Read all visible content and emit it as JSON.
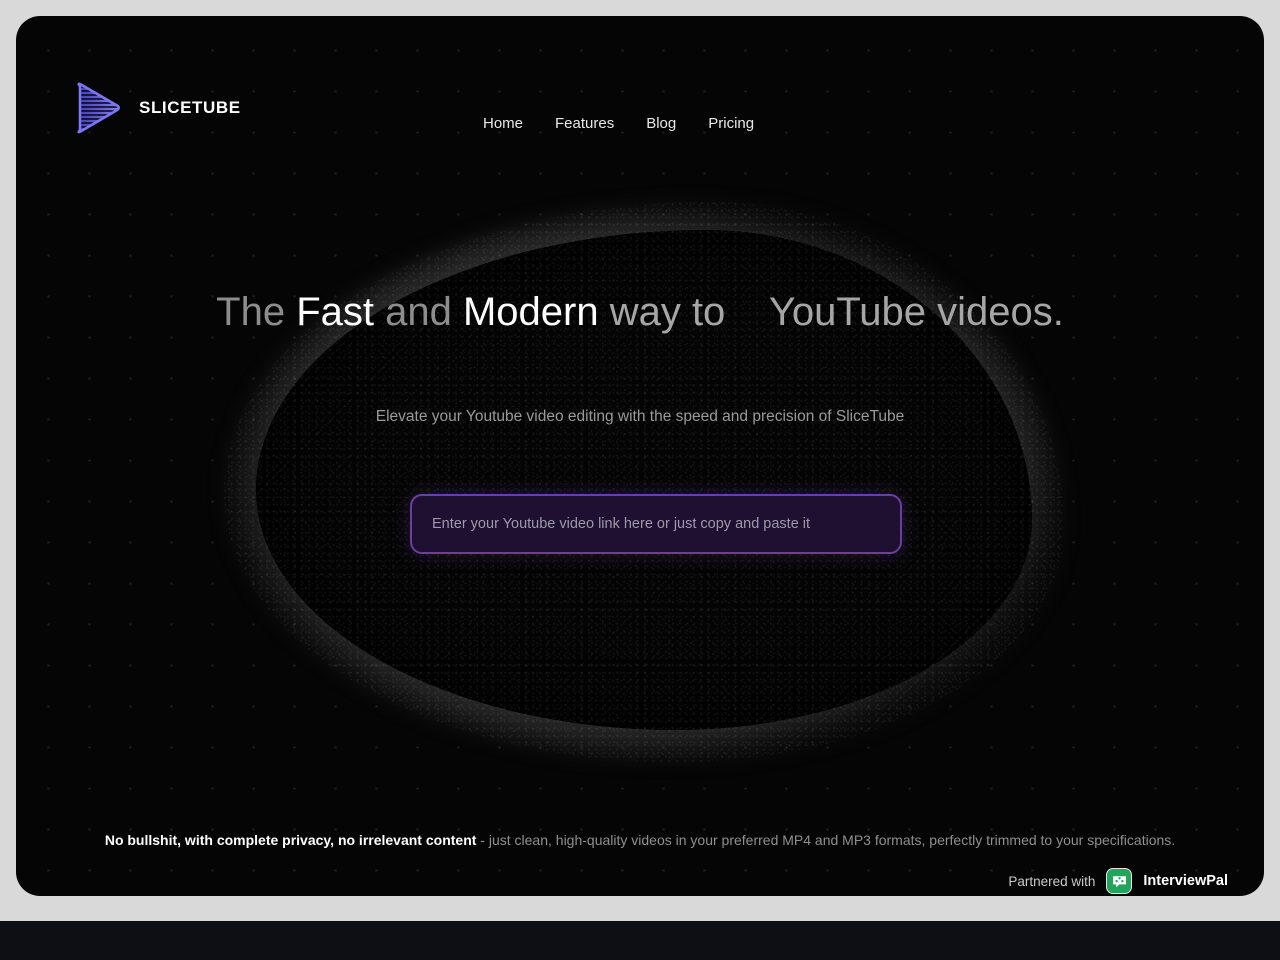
{
  "brand": {
    "name": "SLICETUBE",
    "logo_icon": "striped-play-triangle-icon"
  },
  "nav": {
    "items": [
      {
        "label": "Home"
      },
      {
        "label": "Features"
      },
      {
        "label": "Blog"
      },
      {
        "label": "Pricing"
      }
    ]
  },
  "hero": {
    "headline": {
      "part1": "The ",
      "part2": "Fast",
      "part3": " and ",
      "part4": "Modern",
      "part5": " way to ",
      "rotating_word": "",
      "part6": " YouTube videos."
    },
    "subheadline": "Elevate your Youtube video editing with the speed and precision of SliceTube",
    "input": {
      "placeholder": "Enter your Youtube video link here or just copy and paste it",
      "value": ""
    }
  },
  "footer": {
    "strong": "No bullshit, with complete privacy, no irrelevant content",
    "rest": " - just clean, high-quality videos in your preferred MP4 and MP3 formats, perfectly trimmed to your specifications."
  },
  "partner": {
    "label": "Partnered with",
    "name": "InterviewPal",
    "icon": "interviewpal-speech-bubble-icon",
    "icon_color": "#22a45d"
  },
  "theme": {
    "page_background": "#d9d9d9",
    "card_background": "#050505",
    "accent_purple": "#6b3fa0",
    "logo_purple": "#6c63e8",
    "below_strip": "#0e0f14"
  }
}
